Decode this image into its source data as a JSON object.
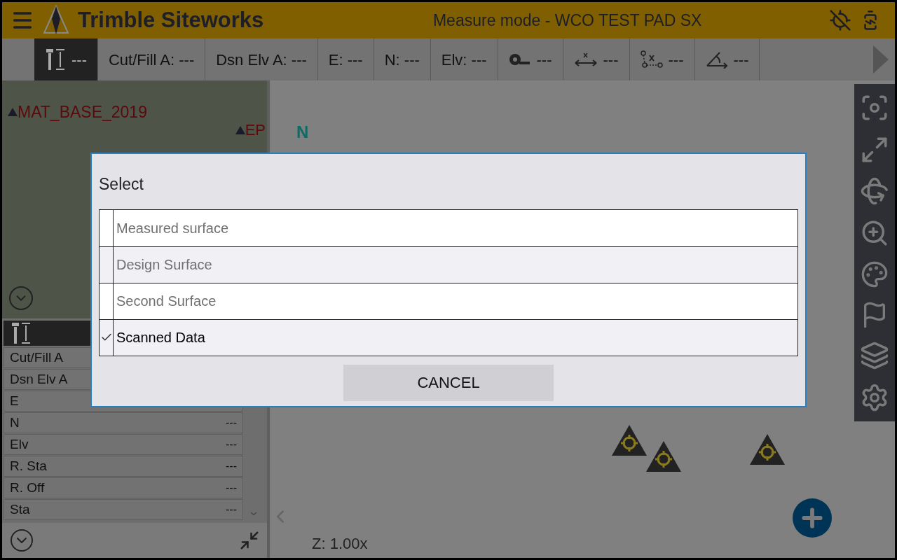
{
  "header": {
    "title": "Trimble Siteworks",
    "mode": "Measure mode - WCO TEST PAD SX"
  },
  "toolbar": {
    "items": [
      {
        "kind": "rod",
        "text": "---",
        "selected": true
      },
      {
        "kind": "text",
        "text": "Cut/Fill A: ---",
        "selected": false
      },
      {
        "kind": "text",
        "text": "Dsn Elv A: ---",
        "selected": false
      },
      {
        "kind": "text",
        "text": "E: ---",
        "selected": false
      },
      {
        "kind": "text",
        "text": "N: ---",
        "selected": false
      },
      {
        "kind": "text",
        "text": "Elv: ---",
        "selected": false
      },
      {
        "kind": "tape",
        "text": "---",
        "selected": false
      },
      {
        "kind": "distance",
        "text": "---",
        "selected": false
      },
      {
        "kind": "offset",
        "text": "---",
        "selected": false
      },
      {
        "kind": "angle",
        "text": "---",
        "selected": false
      }
    ]
  },
  "map_labels": [
    {
      "text": "MAT_BASE_2019"
    },
    {
      "text": "EP"
    }
  ],
  "compass": "N",
  "info_rows": [
    {
      "label": "Cut/Fill A"
    },
    {
      "label": "Dsn Elv A"
    },
    {
      "label": "E"
    },
    {
      "label": "N",
      "value": "---"
    },
    {
      "label": "Elv",
      "value": "---"
    },
    {
      "label": "R. Sta",
      "value": "---"
    },
    {
      "label": "R. Off",
      "value": "---"
    },
    {
      "label": "Sta",
      "value": "---"
    }
  ],
  "zoom": "Z: 1.00x",
  "dialog": {
    "title": "Select",
    "options": [
      {
        "label": "Measured surface",
        "checked": false
      },
      {
        "label": "Design Surface",
        "checked": false
      },
      {
        "label": "Second Surface",
        "checked": false
      },
      {
        "label": "Scanned Data",
        "checked": true
      }
    ],
    "cancel": "CANCEL"
  }
}
